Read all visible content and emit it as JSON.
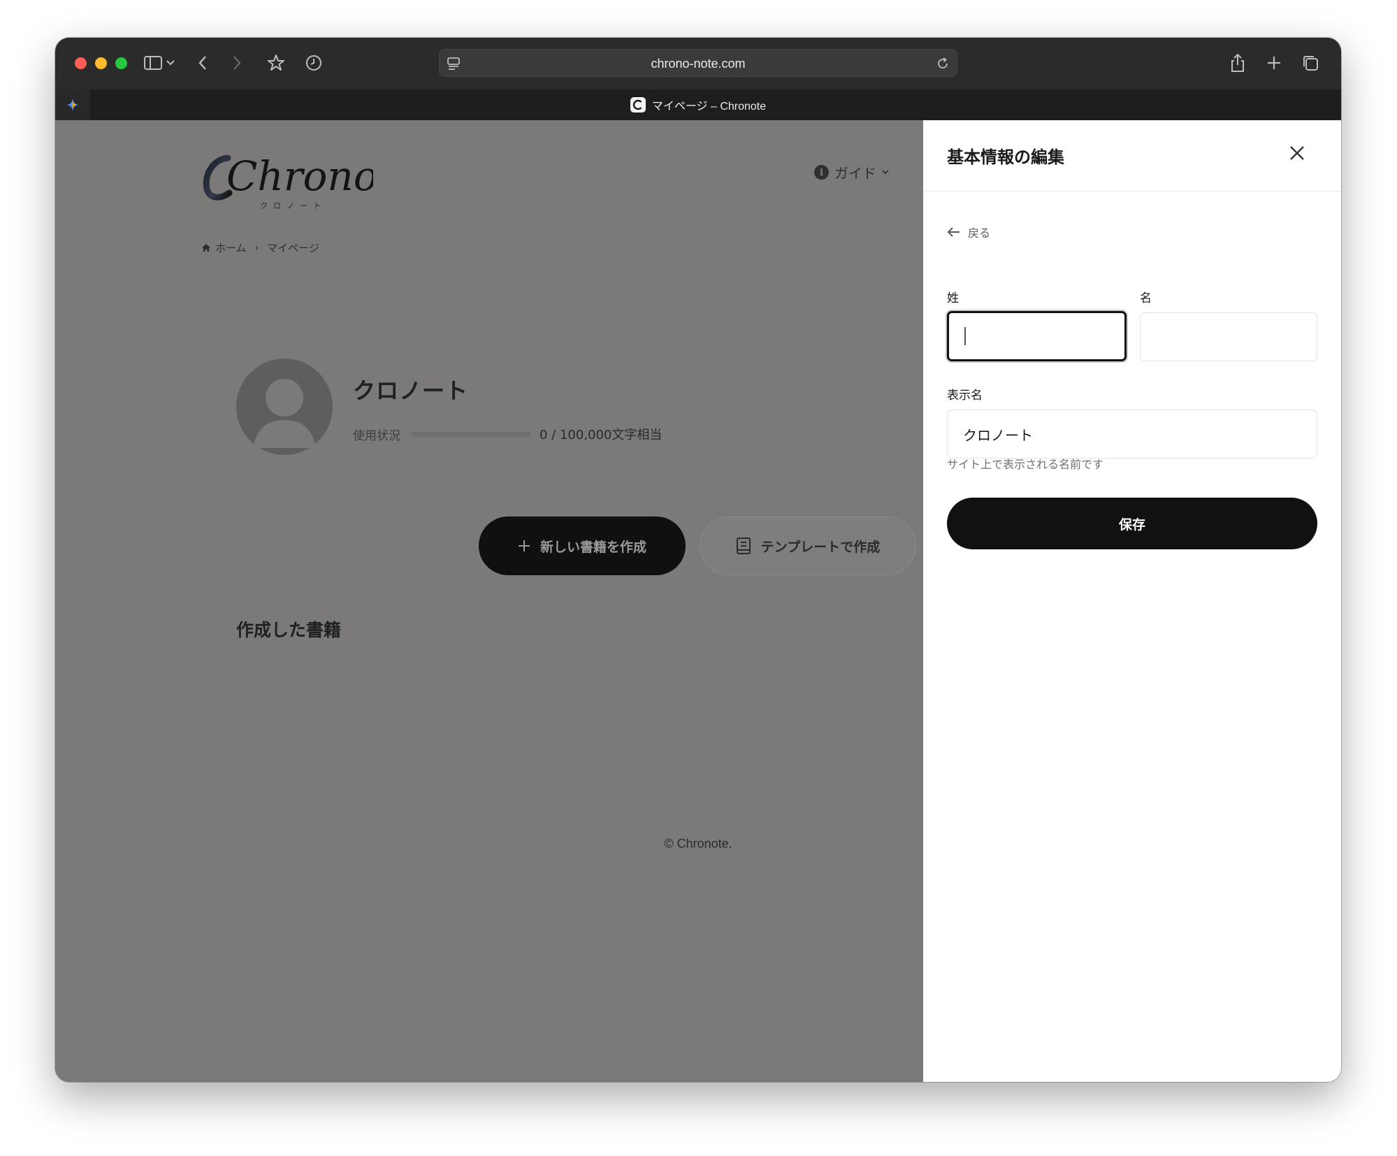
{
  "browser": {
    "url": "chrono-note.com",
    "tab_title": "マイページ – Chronote"
  },
  "page": {
    "logo_text": "Chronote",
    "logo_subtext": "クロノート",
    "nav_guide": "ガイド",
    "breadcrumb": [
      "ホーム",
      "マイページ"
    ],
    "profile": {
      "name": "クロノート",
      "usage_label": "使用状況",
      "usage_value": "0 / 100,000文字相当",
      "usage_fraction": 0
    },
    "buttons": {
      "new_book": "新しい書籍を作成",
      "template": "テンプレートで作成"
    },
    "section_title": "作成した書籍",
    "footer": "© Chronote."
  },
  "panel": {
    "title": "基本情報の編集",
    "back": "戻る",
    "last_name_label": "姓",
    "last_name_value": "",
    "first_name_label": "名",
    "first_name_value": "",
    "display_name_label": "表示名",
    "display_name_value": "クロノート",
    "display_name_hint": "サイト上で表示される名前です",
    "save": "保存"
  },
  "colors": {
    "overlay_dim": "#7b7a78",
    "primary_button": "#111111",
    "panel_bg": "#ffffff"
  }
}
